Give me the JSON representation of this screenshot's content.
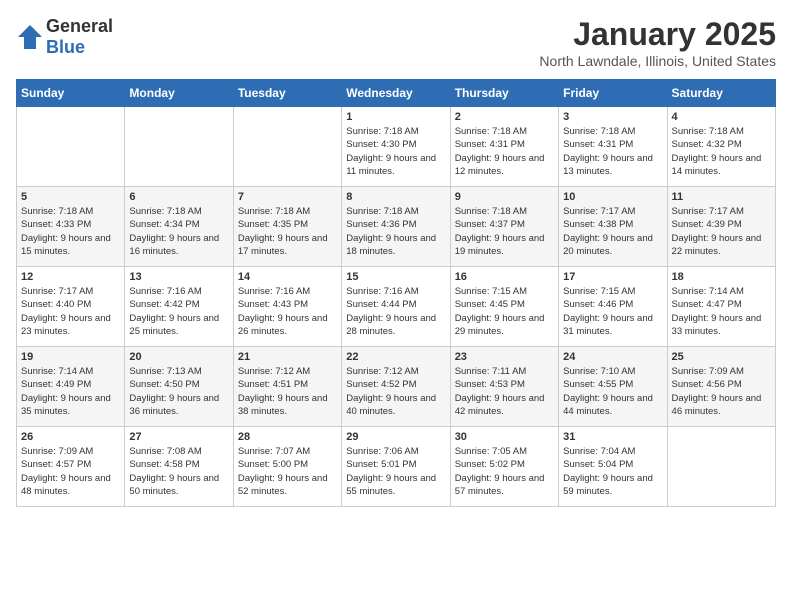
{
  "logo": {
    "text_general": "General",
    "text_blue": "Blue"
  },
  "header": {
    "title": "January 2025",
    "subtitle": "North Lawndale, Illinois, United States"
  },
  "weekdays": [
    "Sunday",
    "Monday",
    "Tuesday",
    "Wednesday",
    "Thursday",
    "Friday",
    "Saturday"
  ],
  "weeks": [
    [
      {
        "day": "",
        "sunrise": "",
        "sunset": "",
        "daylight": ""
      },
      {
        "day": "",
        "sunrise": "",
        "sunset": "",
        "daylight": ""
      },
      {
        "day": "",
        "sunrise": "",
        "sunset": "",
        "daylight": ""
      },
      {
        "day": "1",
        "sunrise": "Sunrise: 7:18 AM",
        "sunset": "Sunset: 4:30 PM",
        "daylight": "Daylight: 9 hours and 11 minutes."
      },
      {
        "day": "2",
        "sunrise": "Sunrise: 7:18 AM",
        "sunset": "Sunset: 4:31 PM",
        "daylight": "Daylight: 9 hours and 12 minutes."
      },
      {
        "day": "3",
        "sunrise": "Sunrise: 7:18 AM",
        "sunset": "Sunset: 4:31 PM",
        "daylight": "Daylight: 9 hours and 13 minutes."
      },
      {
        "day": "4",
        "sunrise": "Sunrise: 7:18 AM",
        "sunset": "Sunset: 4:32 PM",
        "daylight": "Daylight: 9 hours and 14 minutes."
      }
    ],
    [
      {
        "day": "5",
        "sunrise": "Sunrise: 7:18 AM",
        "sunset": "Sunset: 4:33 PM",
        "daylight": "Daylight: 9 hours and 15 minutes."
      },
      {
        "day": "6",
        "sunrise": "Sunrise: 7:18 AM",
        "sunset": "Sunset: 4:34 PM",
        "daylight": "Daylight: 9 hours and 16 minutes."
      },
      {
        "day": "7",
        "sunrise": "Sunrise: 7:18 AM",
        "sunset": "Sunset: 4:35 PM",
        "daylight": "Daylight: 9 hours and 17 minutes."
      },
      {
        "day": "8",
        "sunrise": "Sunrise: 7:18 AM",
        "sunset": "Sunset: 4:36 PM",
        "daylight": "Daylight: 9 hours and 18 minutes."
      },
      {
        "day": "9",
        "sunrise": "Sunrise: 7:18 AM",
        "sunset": "Sunset: 4:37 PM",
        "daylight": "Daylight: 9 hours and 19 minutes."
      },
      {
        "day": "10",
        "sunrise": "Sunrise: 7:17 AM",
        "sunset": "Sunset: 4:38 PM",
        "daylight": "Daylight: 9 hours and 20 minutes."
      },
      {
        "day": "11",
        "sunrise": "Sunrise: 7:17 AM",
        "sunset": "Sunset: 4:39 PM",
        "daylight": "Daylight: 9 hours and 22 minutes."
      }
    ],
    [
      {
        "day": "12",
        "sunrise": "Sunrise: 7:17 AM",
        "sunset": "Sunset: 4:40 PM",
        "daylight": "Daylight: 9 hours and 23 minutes."
      },
      {
        "day": "13",
        "sunrise": "Sunrise: 7:16 AM",
        "sunset": "Sunset: 4:42 PM",
        "daylight": "Daylight: 9 hours and 25 minutes."
      },
      {
        "day": "14",
        "sunrise": "Sunrise: 7:16 AM",
        "sunset": "Sunset: 4:43 PM",
        "daylight": "Daylight: 9 hours and 26 minutes."
      },
      {
        "day": "15",
        "sunrise": "Sunrise: 7:16 AM",
        "sunset": "Sunset: 4:44 PM",
        "daylight": "Daylight: 9 hours and 28 minutes."
      },
      {
        "day": "16",
        "sunrise": "Sunrise: 7:15 AM",
        "sunset": "Sunset: 4:45 PM",
        "daylight": "Daylight: 9 hours and 29 minutes."
      },
      {
        "day": "17",
        "sunrise": "Sunrise: 7:15 AM",
        "sunset": "Sunset: 4:46 PM",
        "daylight": "Daylight: 9 hours and 31 minutes."
      },
      {
        "day": "18",
        "sunrise": "Sunrise: 7:14 AM",
        "sunset": "Sunset: 4:47 PM",
        "daylight": "Daylight: 9 hours and 33 minutes."
      }
    ],
    [
      {
        "day": "19",
        "sunrise": "Sunrise: 7:14 AM",
        "sunset": "Sunset: 4:49 PM",
        "daylight": "Daylight: 9 hours and 35 minutes."
      },
      {
        "day": "20",
        "sunrise": "Sunrise: 7:13 AM",
        "sunset": "Sunset: 4:50 PM",
        "daylight": "Daylight: 9 hours and 36 minutes."
      },
      {
        "day": "21",
        "sunrise": "Sunrise: 7:12 AM",
        "sunset": "Sunset: 4:51 PM",
        "daylight": "Daylight: 9 hours and 38 minutes."
      },
      {
        "day": "22",
        "sunrise": "Sunrise: 7:12 AM",
        "sunset": "Sunset: 4:52 PM",
        "daylight": "Daylight: 9 hours and 40 minutes."
      },
      {
        "day": "23",
        "sunrise": "Sunrise: 7:11 AM",
        "sunset": "Sunset: 4:53 PM",
        "daylight": "Daylight: 9 hours and 42 minutes."
      },
      {
        "day": "24",
        "sunrise": "Sunrise: 7:10 AM",
        "sunset": "Sunset: 4:55 PM",
        "daylight": "Daylight: 9 hours and 44 minutes."
      },
      {
        "day": "25",
        "sunrise": "Sunrise: 7:09 AM",
        "sunset": "Sunset: 4:56 PM",
        "daylight": "Daylight: 9 hours and 46 minutes."
      }
    ],
    [
      {
        "day": "26",
        "sunrise": "Sunrise: 7:09 AM",
        "sunset": "Sunset: 4:57 PM",
        "daylight": "Daylight: 9 hours and 48 minutes."
      },
      {
        "day": "27",
        "sunrise": "Sunrise: 7:08 AM",
        "sunset": "Sunset: 4:58 PM",
        "daylight": "Daylight: 9 hours and 50 minutes."
      },
      {
        "day": "28",
        "sunrise": "Sunrise: 7:07 AM",
        "sunset": "Sunset: 5:00 PM",
        "daylight": "Daylight: 9 hours and 52 minutes."
      },
      {
        "day": "29",
        "sunrise": "Sunrise: 7:06 AM",
        "sunset": "Sunset: 5:01 PM",
        "daylight": "Daylight: 9 hours and 55 minutes."
      },
      {
        "day": "30",
        "sunrise": "Sunrise: 7:05 AM",
        "sunset": "Sunset: 5:02 PM",
        "daylight": "Daylight: 9 hours and 57 minutes."
      },
      {
        "day": "31",
        "sunrise": "Sunrise: 7:04 AM",
        "sunset": "Sunset: 5:04 PM",
        "daylight": "Daylight: 9 hours and 59 minutes."
      },
      {
        "day": "",
        "sunrise": "",
        "sunset": "",
        "daylight": ""
      }
    ]
  ]
}
